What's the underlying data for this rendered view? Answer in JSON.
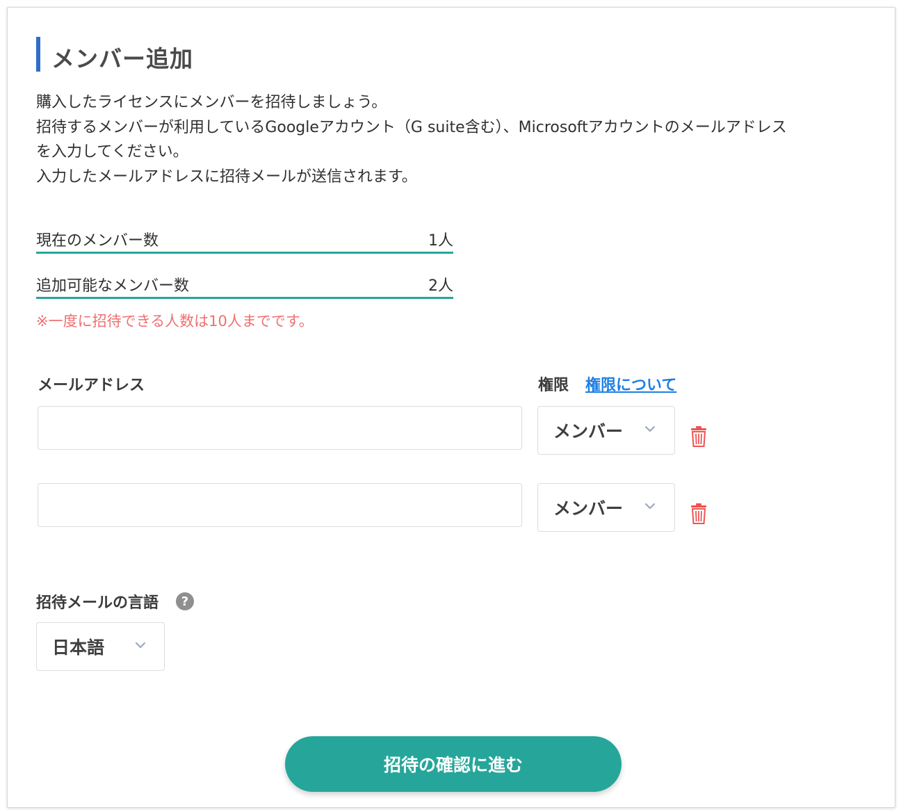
{
  "page": {
    "title": "メンバー追加",
    "description_lines": [
      "購入したライセンスにメンバーを招待しましょう。",
      "招待するメンバーが利用しているGoogleアカウント（G suite含む）、Microsoftアカウントのメールアドレス",
      "を入力してください。",
      "入力したメールアドレスに招待メールが送信されます。"
    ]
  },
  "stats": {
    "current_label": "現在のメンバー数",
    "current_value": "1人",
    "available_label": "追加可能なメンバー数",
    "available_value": "2人",
    "limit_note": "※一度に招待できる人数は10人までです。"
  },
  "form": {
    "email_header": "メールアドレス",
    "role_header": "権限",
    "role_help_link": "権限について",
    "rows": [
      {
        "email_value": "",
        "role": "メンバー"
      },
      {
        "email_value": "",
        "role": "メンバー"
      }
    ],
    "language_label": "招待メールの言語",
    "language_help_symbol": "?",
    "language_value": "日本語",
    "submit_label": "招待の確認に進む"
  },
  "icons": {
    "title_accent": "title-accent-bar",
    "dropdown": "chevron-down-icon",
    "delete": "trash-icon",
    "help": "question-icon"
  },
  "colors": {
    "accent_blue": "#2f6fc6",
    "teal": "#26a69a",
    "link_blue": "#1e7fe3",
    "warning_red": "#ef7070",
    "trash_red": "#ef5350"
  }
}
